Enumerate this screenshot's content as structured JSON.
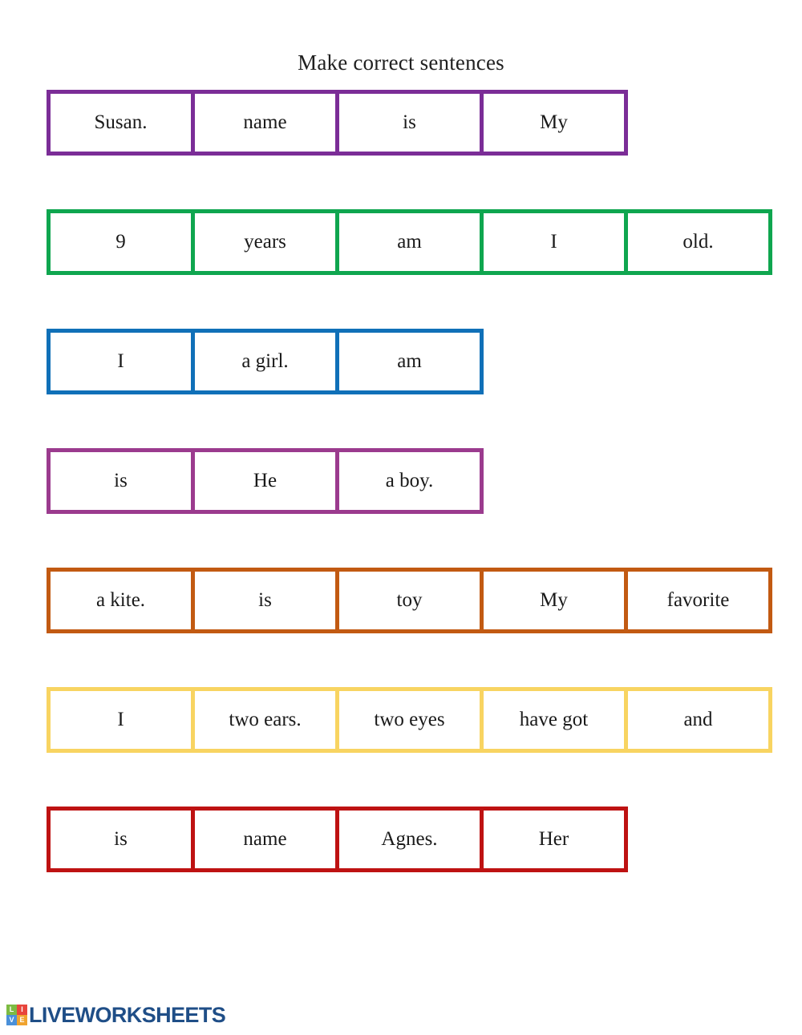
{
  "page": {
    "title": "Make correct sentences",
    "background_color": "#ffffff",
    "text_color": "#1a1a1a"
  },
  "sentences": [
    {
      "index": 1,
      "color": "#7B2D97",
      "color_name": "purple",
      "words": [
        "Susan.",
        "name",
        "is",
        "My"
      ]
    },
    {
      "index": 2,
      "color": "#0FA64F",
      "color_name": "green",
      "words": [
        "9",
        "years",
        "am",
        "I",
        "old."
      ]
    },
    {
      "index": 3,
      "color": "#1070B8",
      "color_name": "blue",
      "words": [
        "I",
        "a girl.",
        "am"
      ]
    },
    {
      "index": 4,
      "color": "#9B3B8E",
      "color_name": "plum",
      "words": [
        "is",
        "He",
        "a boy."
      ]
    },
    {
      "index": 5,
      "color": "#C25A12",
      "color_name": "orange",
      "words": [
        "a kite.",
        "is",
        "toy",
        "My",
        "favorite"
      ]
    },
    {
      "index": 6,
      "color": "#F8D461",
      "color_name": "yellow",
      "words": [
        "I",
        "two ears.",
        "two eyes",
        "have got",
        "and"
      ]
    },
    {
      "index": 7,
      "color": "#BE1212",
      "color_name": "red",
      "words": [
        "is",
        "name",
        "Agnes.",
        "Her"
      ]
    }
  ],
  "footer": {
    "wordmark": "LIVEWORKSHEETS",
    "wordmark_color": "#1F4E87",
    "logo_tiles": [
      {
        "letter": "L",
        "color": "#7DBB42"
      },
      {
        "letter": "I",
        "color": "#E8453C"
      },
      {
        "letter": "V",
        "color": "#4A90D9"
      },
      {
        "letter": "E",
        "color": "#F0A32E"
      }
    ]
  }
}
